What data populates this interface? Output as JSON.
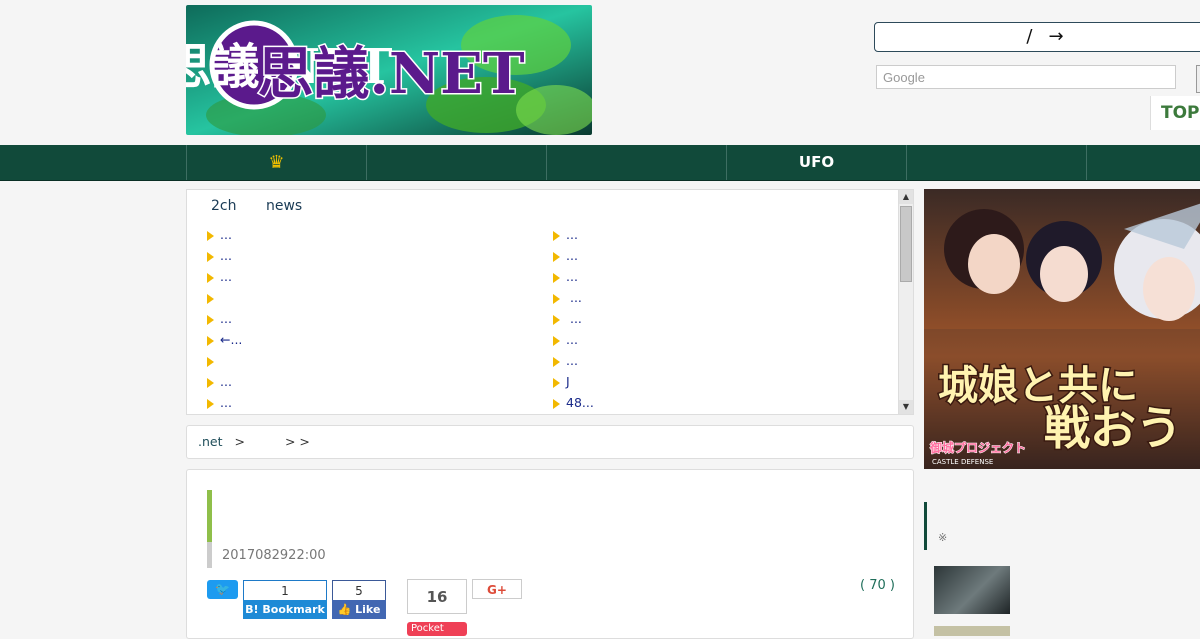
{
  "header": {
    "logo_text": "不思議.NET",
    "link_box": {
      "slash": "/",
      "arrow": "→"
    },
    "search_placeholder": "Google",
    "top_label": "TOP"
  },
  "nav": {
    "items": [
      {
        "label": "",
        "icon": "crown-icon"
      },
      {
        "label": ""
      },
      {
        "label": ""
      },
      {
        "label": "UFO"
      },
      {
        "label": ""
      },
      {
        "label": ""
      }
    ]
  },
  "news": {
    "tabs": [
      "2ch",
      "news"
    ],
    "left": [
      "...",
      "...",
      "...",
      "",
      "...",
      "←...",
      "",
      "...",
      "..."
    ],
    "right": [
      "...",
      "...",
      "...",
      " ...",
      " ...",
      "...",
      "...",
      "J",
      "48..."
    ]
  },
  "breadcrumb": {
    "site": ".net",
    "sep1": ">",
    "sep2": "> >"
  },
  "article": {
    "date": "2017082922:00",
    "comment_count": "( 70 )",
    "social": {
      "hatena_count": "1",
      "hatena_label": "B! Bookmark",
      "fb_count": "5",
      "fb_label": "Like",
      "pocket_count": "16",
      "pocket_label": "Pocket",
      "gplus_label": "G+"
    }
  },
  "sidebar": {
    "ad_line1": "城娘と共に",
    "ad_line2": "戦おう",
    "ad_logo": "御城プロジェクト",
    "ad_logo_sub": "CASTLE DEFENSE",
    "note": "※"
  },
  "colors": {
    "nav_bg": "#114a3a",
    "accent_green": "#8fbf4a",
    "bullet_yellow": "#f2b800",
    "link_blue": "#1a2a8a"
  }
}
